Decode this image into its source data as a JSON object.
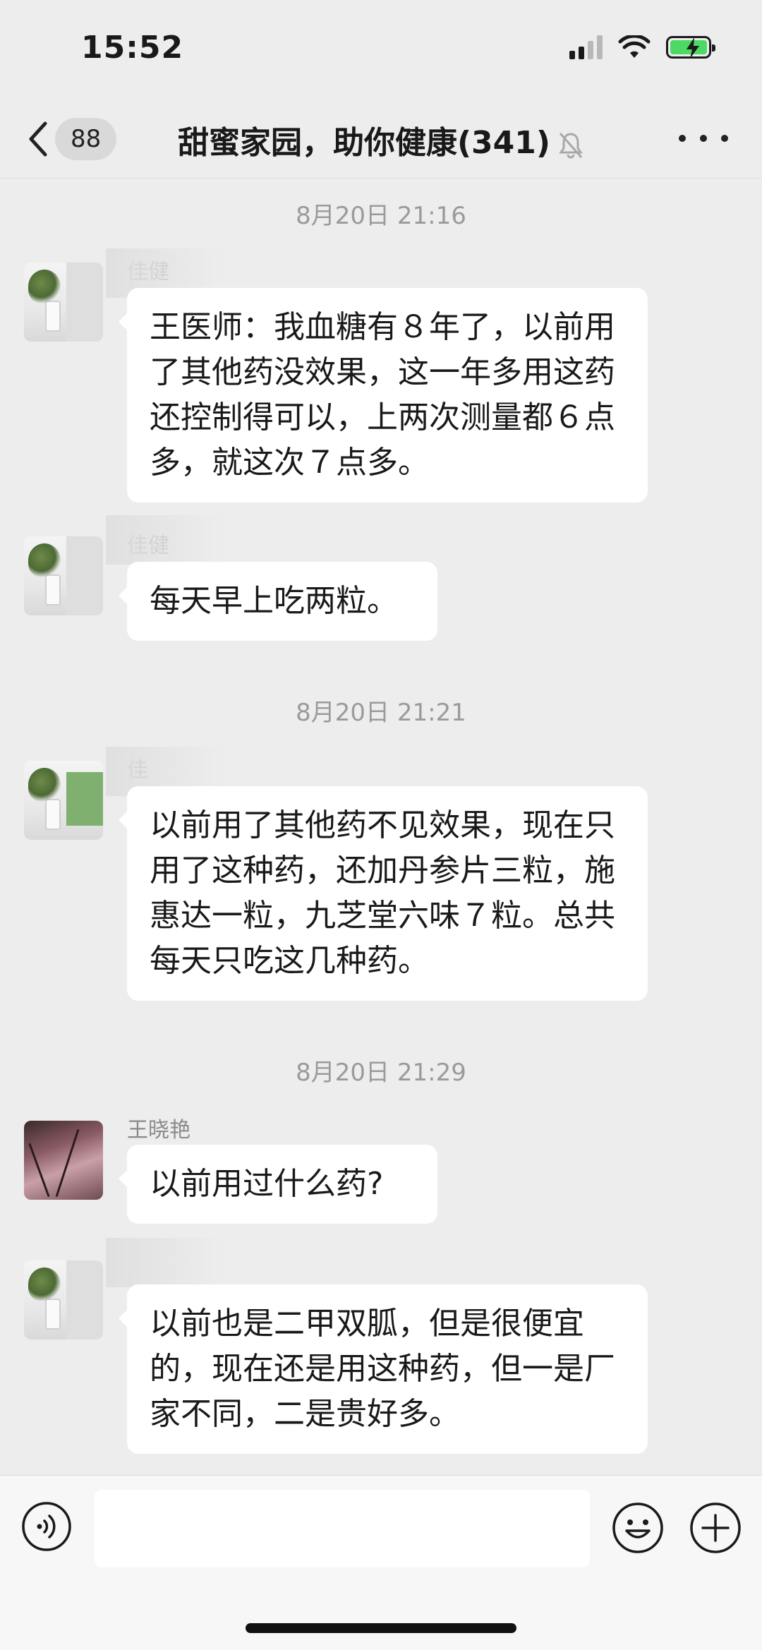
{
  "status_bar": {
    "time": "15:52"
  },
  "nav": {
    "unread_count": "88",
    "title": "甜蜜家园，助你健康(341)"
  },
  "messages": [
    {
      "timestamp": "8月20日 21:16"
    },
    {
      "sender": "佳健",
      "text": "王医师：我血糖有８年了，以前用了其他药没效果，这一年多用这药还控制得可以，上两次测量都６点多，就这次７点多。"
    },
    {
      "sender": "佳健",
      "text": "每天早上吃两粒。"
    },
    {
      "timestamp": "8月20日 21:21"
    },
    {
      "sender": "佳",
      "text": "以前用了其他药不见效果，现在只用了这种药，还加丹参片三粒，施惠达一粒，九芝堂六味７粒。总共每天只吃这几种药。"
    },
    {
      "timestamp": "8月20日 21:29"
    },
    {
      "sender": "王晓艳",
      "text": "以前用过什么药?"
    },
    {
      "text": "以前也是二甲双胍，但是很便宜的，现在还是用这种药，但一是厂家不同，二是贵好多。"
    }
  ],
  "input_bar": {
    "placeholder": ""
  },
  "icons": {
    "back": "chevron-left-icon",
    "mute": "bell-slash-icon",
    "more": "more-dots-icon",
    "voice": "voice-icon",
    "emoji": "emoji-icon",
    "plus": "plus-circle-icon"
  }
}
